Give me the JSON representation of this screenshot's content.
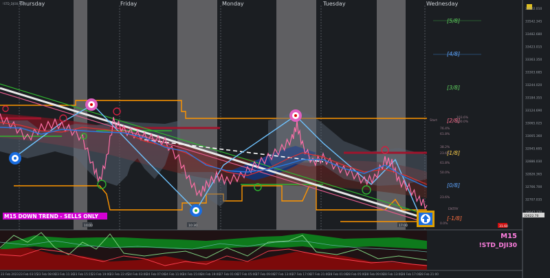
{
  "window": {
    "symbol_header": "!STD_DJI30,M15",
    "days": [
      "Thursday",
      "Friday",
      "Monday",
      "Tuesday",
      "Wednesday"
    ]
  },
  "murrey": {
    "levels": [
      "[5/8]",
      "[4/8]",
      "[3/8]",
      "[2/8]",
      "[1/8]",
      "[0/8]",
      "[-1/8]"
    ],
    "fibs": [
      "61.8%",
      "38.2%",
      "23.6%",
      "76.4%",
      "61.8%",
      "50.0%",
      "23.6%",
      "0.0%"
    ],
    "side_labels": [
      "Start",
      "ENTRY",
      "TP"
    ],
    "upper_tags": [
      "103.6%",
      "100.0%"
    ]
  },
  "price_axis": {
    "ticks": [
      "33602.010",
      "33542.345",
      "33482.680",
      "33423.015",
      "33363.350",
      "33303.685",
      "33244.020",
      "33184.355",
      "33124.690",
      "33065.025",
      "33005.360",
      "32945.695",
      "32886.030",
      "32826.365",
      "32766.700",
      "32707.035",
      "32647.370"
    ],
    "current_price": "32622.70",
    "red_tag": "31.60"
  },
  "banner": {
    "trend_text": "M15  DOWN TREND - SELLS ONLY",
    "signal_icon": "up-arrow-icon"
  },
  "indicator": {
    "timeframe": "M15",
    "symbol": "!STD_DJI30"
  },
  "time_axis": {
    "labels": [
      "23 Feb 2023",
      "23 Feb 03:15",
      "23 Feb 08:00",
      "23 Feb 11:30",
      "23 Feb 15:15",
      "23 Feb 19:00",
      "23 Feb 22:45",
      "24 Feb 03:00",
      "24 Feb 07:00",
      "24 Feb 11:00",
      "24 Feb 15:00",
      "24 Feb 19:00",
      "27 Feb 01:00",
      "27 Feb 05:00",
      "27 Feb 09:00",
      "27 Feb 13:00",
      "27 Feb 17:00",
      "27 Feb 21:00",
      "28 Feb 01:00",
      "28 Feb 05:00",
      "28 Feb 09:00",
      "28 Feb 13:00",
      "28 Feb 17:00",
      "28 Feb 21:00"
    ]
  },
  "zone_labels": [
    "10:00",
    "10:30",
    "17:00"
  ],
  "colors": {
    "background": "#1b1e22",
    "session_band": "#5f5f62",
    "orange_line": "#ff9500",
    "sell_banner": "#d400d4",
    "signal_box": "#e0a000",
    "indicator_green": "#0e7a1c",
    "indicator_red": "#7c0a0a"
  }
}
